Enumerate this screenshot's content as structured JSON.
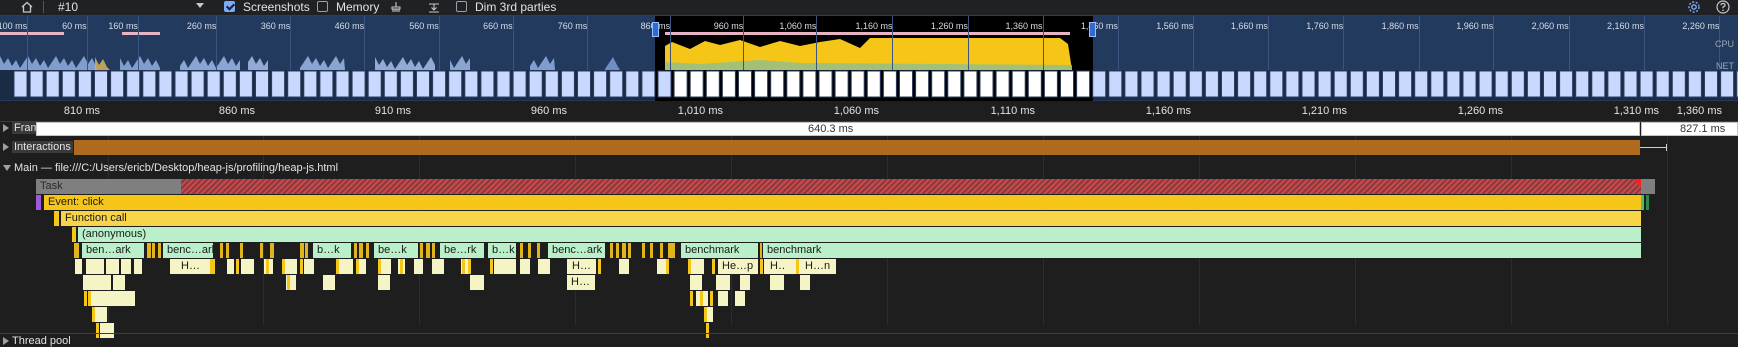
{
  "toolbar": {
    "recording_label": "#10",
    "screenshots_label": "Screenshots",
    "screenshots_checked": true,
    "memory_label": "Memory",
    "memory_checked": false,
    "dim_label": "Dim 3rd parties",
    "dim_checked": false,
    "icons": [
      "home-icon",
      "dropdown-icon",
      "broom-icon",
      "capture-icon",
      "settings-icon",
      "help-icon"
    ]
  },
  "overview": {
    "ticks": [
      "100 ms",
      "60 ms",
      "160 ms",
      "260 ms",
      "360 ms",
      "460 ms",
      "560 ms",
      "660 ms",
      "760 ms",
      "860 ms",
      "960 ms",
      "1,060 ms",
      "1,160 ms",
      "1,260 ms",
      "1,360 ms",
      "1,460 ms",
      "1,560 ms",
      "1,660 ms",
      "1,760 ms",
      "1,860 ms",
      "1,960 ms",
      "2,060 ms",
      "2,160 ms",
      "2,260 ms"
    ],
    "cpu_label": "CPU",
    "net_label": "NET"
  },
  "ruler": {
    "ticks": [
      "810 ms",
      "860 ms",
      "910 ms",
      "960 ms",
      "1,010 ms",
      "1,060 ms",
      "1,110 ms",
      "1,160 ms",
      "1,210 ms",
      "1,260 ms",
      "1,310 ms",
      "1,360 ms"
    ]
  },
  "tracks": {
    "frames": {
      "label": "Frames",
      "frame1": "640.3 ms",
      "frame2": "827.1 ms"
    },
    "interactions": {
      "label": "Interactions"
    },
    "main": {
      "label": "Main — file:///C:/Users/ericb/Desktop/heap-js/profiling/heap-js.html"
    },
    "thread_pool": {
      "label": "Thread pool"
    }
  },
  "flame": {
    "task": "Task",
    "event": "Event: click",
    "function_call": "Function call",
    "anonymous": "(anonymous)",
    "benchmarks": [
      "ben…ark",
      "benc…ark",
      "b…k",
      "be…k",
      "be…rk",
      "b…k",
      "benc…ark",
      "benchmark",
      "benchmark"
    ],
    "subs": [
      "H…",
      "H…",
      "H…",
      "He…p",
      "H…",
      "H…n",
      "H…"
    ]
  },
  "colors": {
    "scripting": "#f5c518",
    "function": "#f8d548",
    "benchmark": "#b9f0c9",
    "heap": "#f4f4c4",
    "task": "#7f7f7f",
    "long_task": "#d8474d",
    "interaction": "#b06a1e",
    "net_bar": "#c9d8ff"
  }
}
